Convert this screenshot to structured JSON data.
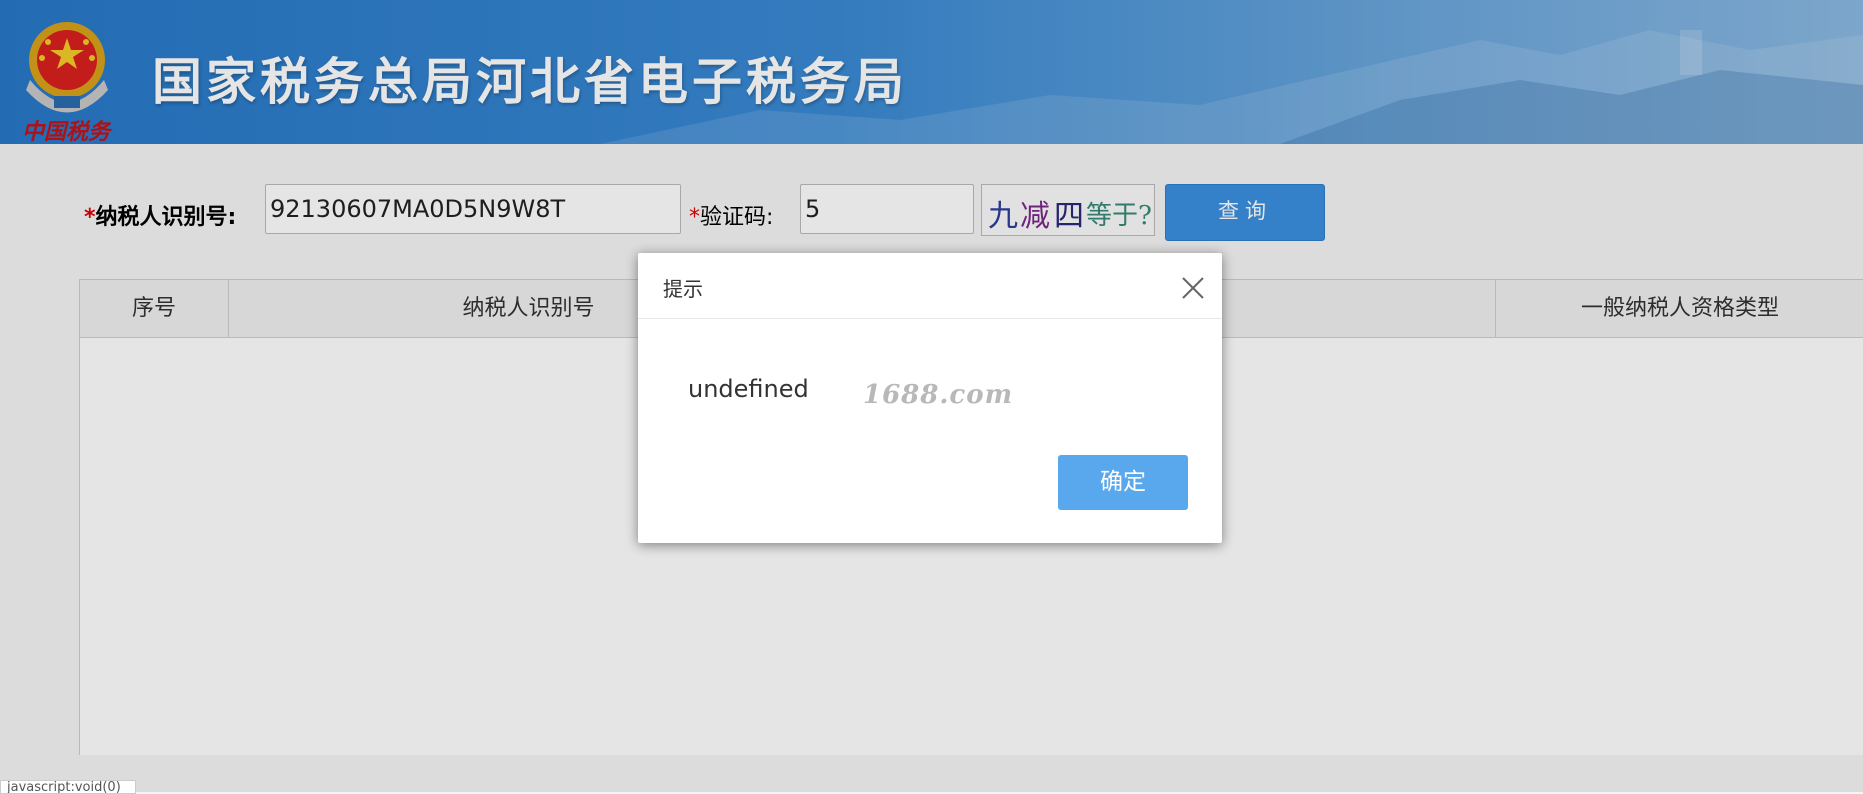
{
  "header": {
    "title": "国家税务总局河北省电子税务局",
    "emblem_text": "中国税务"
  },
  "form": {
    "taxpayer_id_label_req": "*",
    "taxpayer_id_label": "纳税人识别号:",
    "taxpayer_id_value": "92130607MA0D5N9W8T",
    "captcha_label_req": "*",
    "captcha_label": "验证码:",
    "captcha_value": "5",
    "captcha_chars": [
      "九",
      "减",
      "四",
      "等于?"
    ],
    "query_button": "查询"
  },
  "table": {
    "columns": [
      "序号",
      "纳税人识别号",
      "一般纳税人资格类型"
    ]
  },
  "dialog": {
    "title": "提示",
    "message": "undefined",
    "watermark": "1688.com",
    "ok_button": "确定"
  },
  "status_bar": {
    "text": "javascript:void(0)"
  },
  "colors": {
    "header_blue": "#2878c8",
    "button_blue": "#3a8fe0",
    "dialog_button": "#59a7ec",
    "required_red": "#e00000"
  }
}
